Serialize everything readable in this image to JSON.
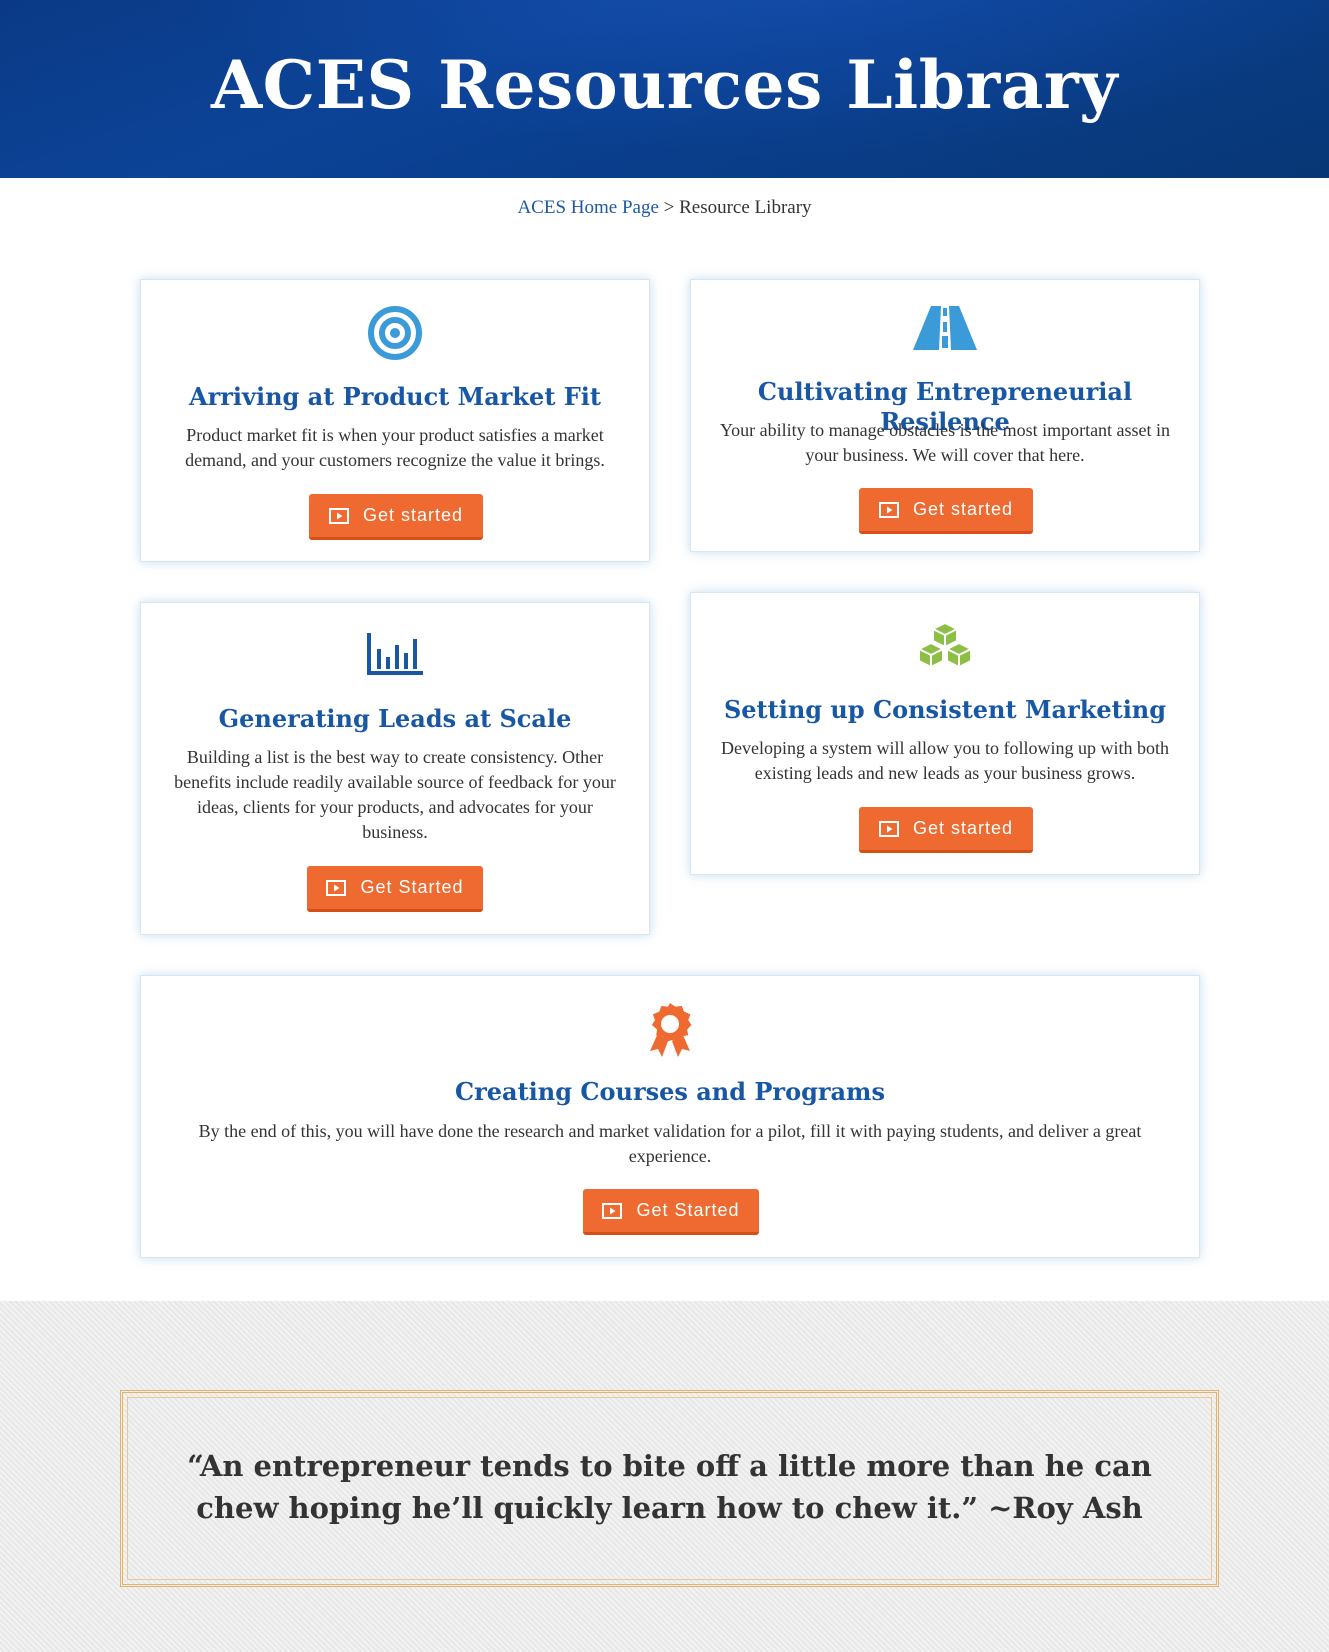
{
  "header": {
    "title": "ACES Resources Library"
  },
  "breadcrumb": {
    "home_link": "ACES Home Page",
    "separator": ">",
    "current": "Resource Library"
  },
  "cards": [
    {
      "icon": "target-icon",
      "title": "Arriving at Product Market Fit",
      "description": "Product market fit is when your product satisfies a market demand, and your customers recognize the value it brings.",
      "button_label": "Get started"
    },
    {
      "icon": "road-icon",
      "title": "Cultivating Entrepreneurial Resilence",
      "description": "Your ability to manage obstacles is the most important asset in your business. We will cover that here.",
      "button_label": "Get started"
    },
    {
      "icon": "bar-chart-icon",
      "title": "Generating Leads at Scale",
      "description": "Building a list is the best way to create consistency. Other benefits include readily available source of feedback for your ideas, clients for your products, and advocates for your business.",
      "button_label": "Get Started"
    },
    {
      "icon": "cubes-icon",
      "title": "Setting up Consistent Marketing",
      "description": "Developing a system will allow you to following up with both existing leads and new leads as your business grows.",
      "button_label": "Get started"
    },
    {
      "icon": "award-ribbon-icon",
      "title": "Creating Courses and Programs",
      "description": "By the end of this, you will have done the research and market validation for a pilot, fill it with paying students, and deliver a great experience.",
      "button_label": "Get Started"
    }
  ],
  "quote": {
    "text": "“An entrepreneur tends to bite off a little more than he can chew hoping he’ll quickly learn how to chew it.” ~Roy Ash"
  },
  "colors": {
    "header_bg": "#0a3f8e",
    "title_blue": "#1757a4",
    "button_orange": "#ee6a30",
    "icon_blue": "#3b9ad8",
    "icon_green": "#8bbf45",
    "icon_orange": "#ee6a30",
    "quote_border": "#e2b46a"
  }
}
